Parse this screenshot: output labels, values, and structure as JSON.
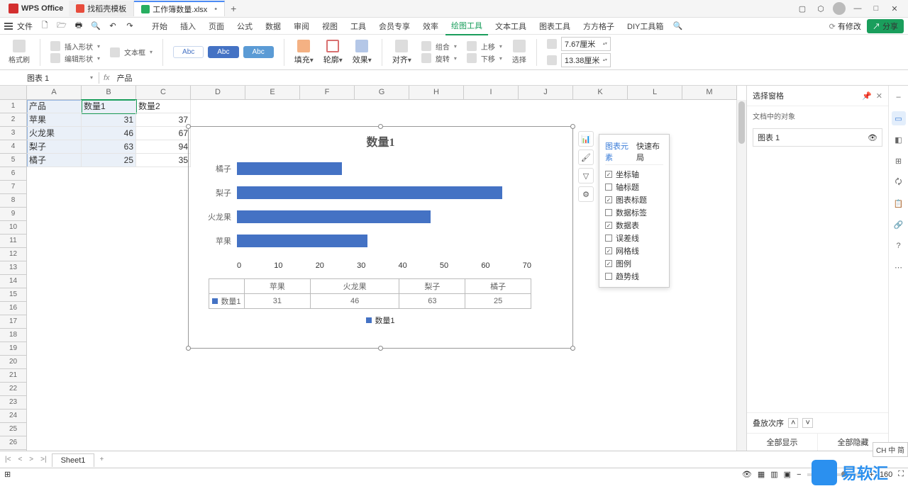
{
  "app": {
    "brand": "WPS Office"
  },
  "tabs": [
    {
      "label": "找稻壳模板"
    },
    {
      "label": "工作簿数量.xlsx"
    }
  ],
  "menubar": {
    "file": "文件",
    "items": [
      "开始",
      "插入",
      "页面",
      "公式",
      "数据",
      "审阅",
      "视图",
      "工具",
      "会员专享",
      "效率",
      "绘图工具",
      "文本工具",
      "图表工具",
      "方方格子",
      "DIY工具箱"
    ],
    "active": "绘图工具",
    "changes": "有修改",
    "share": "分享"
  },
  "ribbon": {
    "fmtbrush": "格式刷",
    "insshape": "插入形状",
    "textbox": "文本框",
    "editshape": "编辑形状",
    "abc": "Abc",
    "fill": "填充",
    "outline": "轮廓",
    "effect": "效果",
    "align": "对齐",
    "group": "组合",
    "rotate": "旋转",
    "up": "上移",
    "down": "下移",
    "selpane": "选择",
    "width": "7.67厘米",
    "height": "13.38厘米"
  },
  "namebox": "图表 1",
  "formula": "产品",
  "cols": [
    "A",
    "B",
    "C",
    "D",
    "E",
    "F",
    "G",
    "H",
    "I",
    "J",
    "K",
    "L",
    "M"
  ],
  "data": {
    "headers": [
      "产品",
      "数量1",
      "数量2"
    ],
    "rows": [
      [
        "苹果",
        31,
        37
      ],
      [
        "火龙果",
        46,
        67
      ],
      [
        "梨子",
        63,
        94
      ],
      [
        "橘子",
        25,
        35
      ]
    ]
  },
  "chart_data": {
    "type": "bar",
    "title": "数量1",
    "categories": [
      "橘子",
      "梨子",
      "火龙果",
      "苹果"
    ],
    "values": [
      25,
      63,
      46,
      31
    ],
    "xlim": [
      0,
      70
    ],
    "xticks": [
      0,
      10,
      20,
      30,
      40,
      50,
      60,
      70
    ],
    "table": {
      "headers": [
        "苹果",
        "火龙果",
        "梨子",
        "橘子"
      ],
      "row_label": "数量1",
      "values": [
        31,
        46,
        63,
        25
      ]
    },
    "legend": "数量1"
  },
  "chart_tools": {
    "tabs": [
      "图表元素",
      "快速布局"
    ],
    "items": [
      {
        "label": "坐标轴",
        "checked": true
      },
      {
        "label": "轴标题",
        "checked": false
      },
      {
        "label": "图表标题",
        "checked": true
      },
      {
        "label": "数据标签",
        "checked": false
      },
      {
        "label": "数据表",
        "checked": true
      },
      {
        "label": "误差线",
        "checked": false
      },
      {
        "label": "网格线",
        "checked": true
      },
      {
        "label": "图例",
        "checked": true
      },
      {
        "label": "趋势线",
        "checked": false
      }
    ]
  },
  "rpanel": {
    "title": "选择窗格",
    "sub": "文档中的对象",
    "item": "图表 1",
    "order": "叠放次序",
    "showall": "全部显示",
    "hideall": "全部隐藏"
  },
  "sheet_tab": "Sheet1",
  "status": {
    "zoom": "160"
  },
  "ime": "CH 中 简",
  "watermark": "易软汇"
}
